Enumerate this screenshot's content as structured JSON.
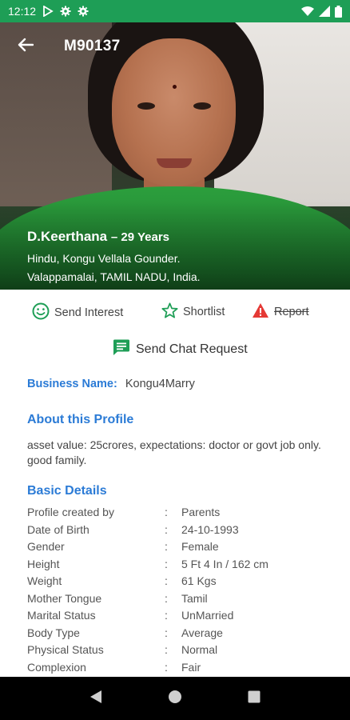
{
  "status_bar": {
    "time": "12:12",
    "left_icons": [
      "play-protect-icon",
      "gear-icon",
      "gear-icon"
    ],
    "right_icons": [
      "wifi-icon",
      "signal-icon",
      "battery-icon"
    ],
    "color": "#1e9e56"
  },
  "header": {
    "profile_id": "M90137",
    "back_icon": "arrow-left-icon"
  },
  "profile": {
    "name": "D.Keerthana",
    "age": "– 29 Years",
    "line1": "Hindu, Kongu Vellala Gounder.",
    "line2": "Valappamalai, TAMIL NADU, India."
  },
  "actions": {
    "interest_label": "Send Interest",
    "shortlist_label": "Shortlist",
    "report_label": "Report",
    "chat_label": "Send Chat Request"
  },
  "business": {
    "key": "Business Name:",
    "value": "Kongu4Marry"
  },
  "about": {
    "title": "About this Profile",
    "text": "asset value: 25crores, expectations: doctor or govt job only. good family."
  },
  "basic": {
    "title": "Basic Details",
    "separator": ":",
    "rows": [
      {
        "key": "Profile created by",
        "value": "Parents"
      },
      {
        "key": "Date of Birth",
        "value": "24-10-1993"
      },
      {
        "key": "Gender",
        "value": "Female"
      },
      {
        "key": "Height",
        "value": "5 Ft 4 In / 162 cm"
      },
      {
        "key": "Weight",
        "value": "61 Kgs"
      },
      {
        "key": "Mother Tongue",
        "value": "Tamil"
      },
      {
        "key": "Marital Status",
        "value": "UnMarried"
      },
      {
        "key": "Body Type",
        "value": "Average"
      },
      {
        "key": "Physical Status",
        "value": "Normal"
      },
      {
        "key": "Complexion",
        "value": "Fair"
      }
    ]
  },
  "colors": {
    "accent_blue": "#2b7bd6",
    "interest_green": "#1e9e56",
    "report_red": "#e53935"
  },
  "nav": {
    "icons": [
      "back-triangle-icon",
      "home-circle-icon",
      "recents-square-icon"
    ]
  }
}
